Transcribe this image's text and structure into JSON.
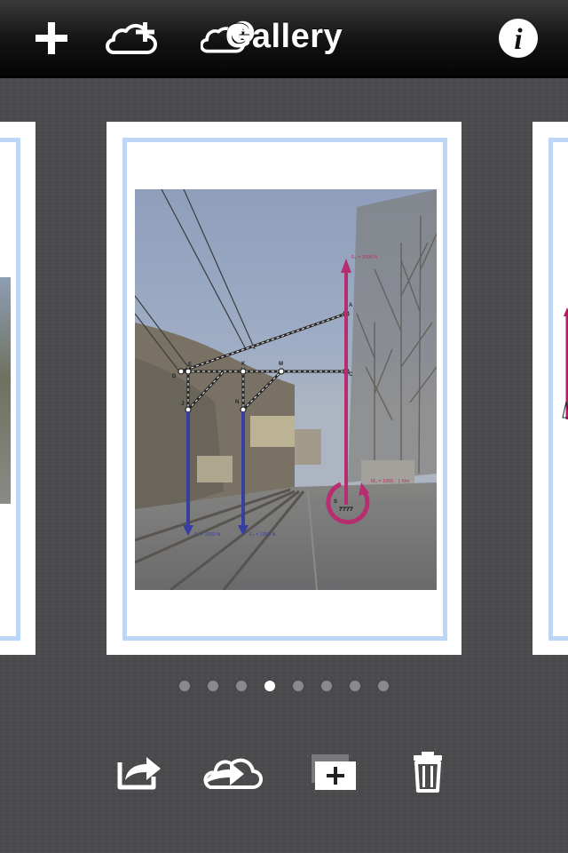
{
  "navbar": {
    "title": "Gallery",
    "buttons": [
      {
        "icon": "plus-icon"
      },
      {
        "icon": "cloud-plus-icon"
      },
      {
        "icon": "cloud-info-icon"
      },
      {
        "icon": "info-icon"
      }
    ]
  },
  "gallery": {
    "page_count": 8,
    "current_page": 4,
    "current_photo": {
      "annotations": {
        "top_force": "F₀ = 2000 N",
        "moment": "M₀ = 1000 · 1 Nm",
        "force_1": "F₁ = 1000 N",
        "force_2": "F₂ = 1000 N",
        "point_labels": [
          "A",
          "C",
          "D",
          "E",
          "K",
          "M",
          "J",
          "N",
          "S"
        ]
      }
    }
  },
  "toolbar": {
    "buttons": [
      {
        "icon": "share-icon"
      },
      {
        "icon": "cloud-upload-icon"
      },
      {
        "icon": "add-to-album-icon"
      },
      {
        "icon": "trash-icon"
      }
    ]
  },
  "colors": {
    "card_border": "#bcd6f5",
    "force_blue": "#27309a",
    "force_magenta": "#b01d64",
    "background": "#4a4a4c"
  }
}
